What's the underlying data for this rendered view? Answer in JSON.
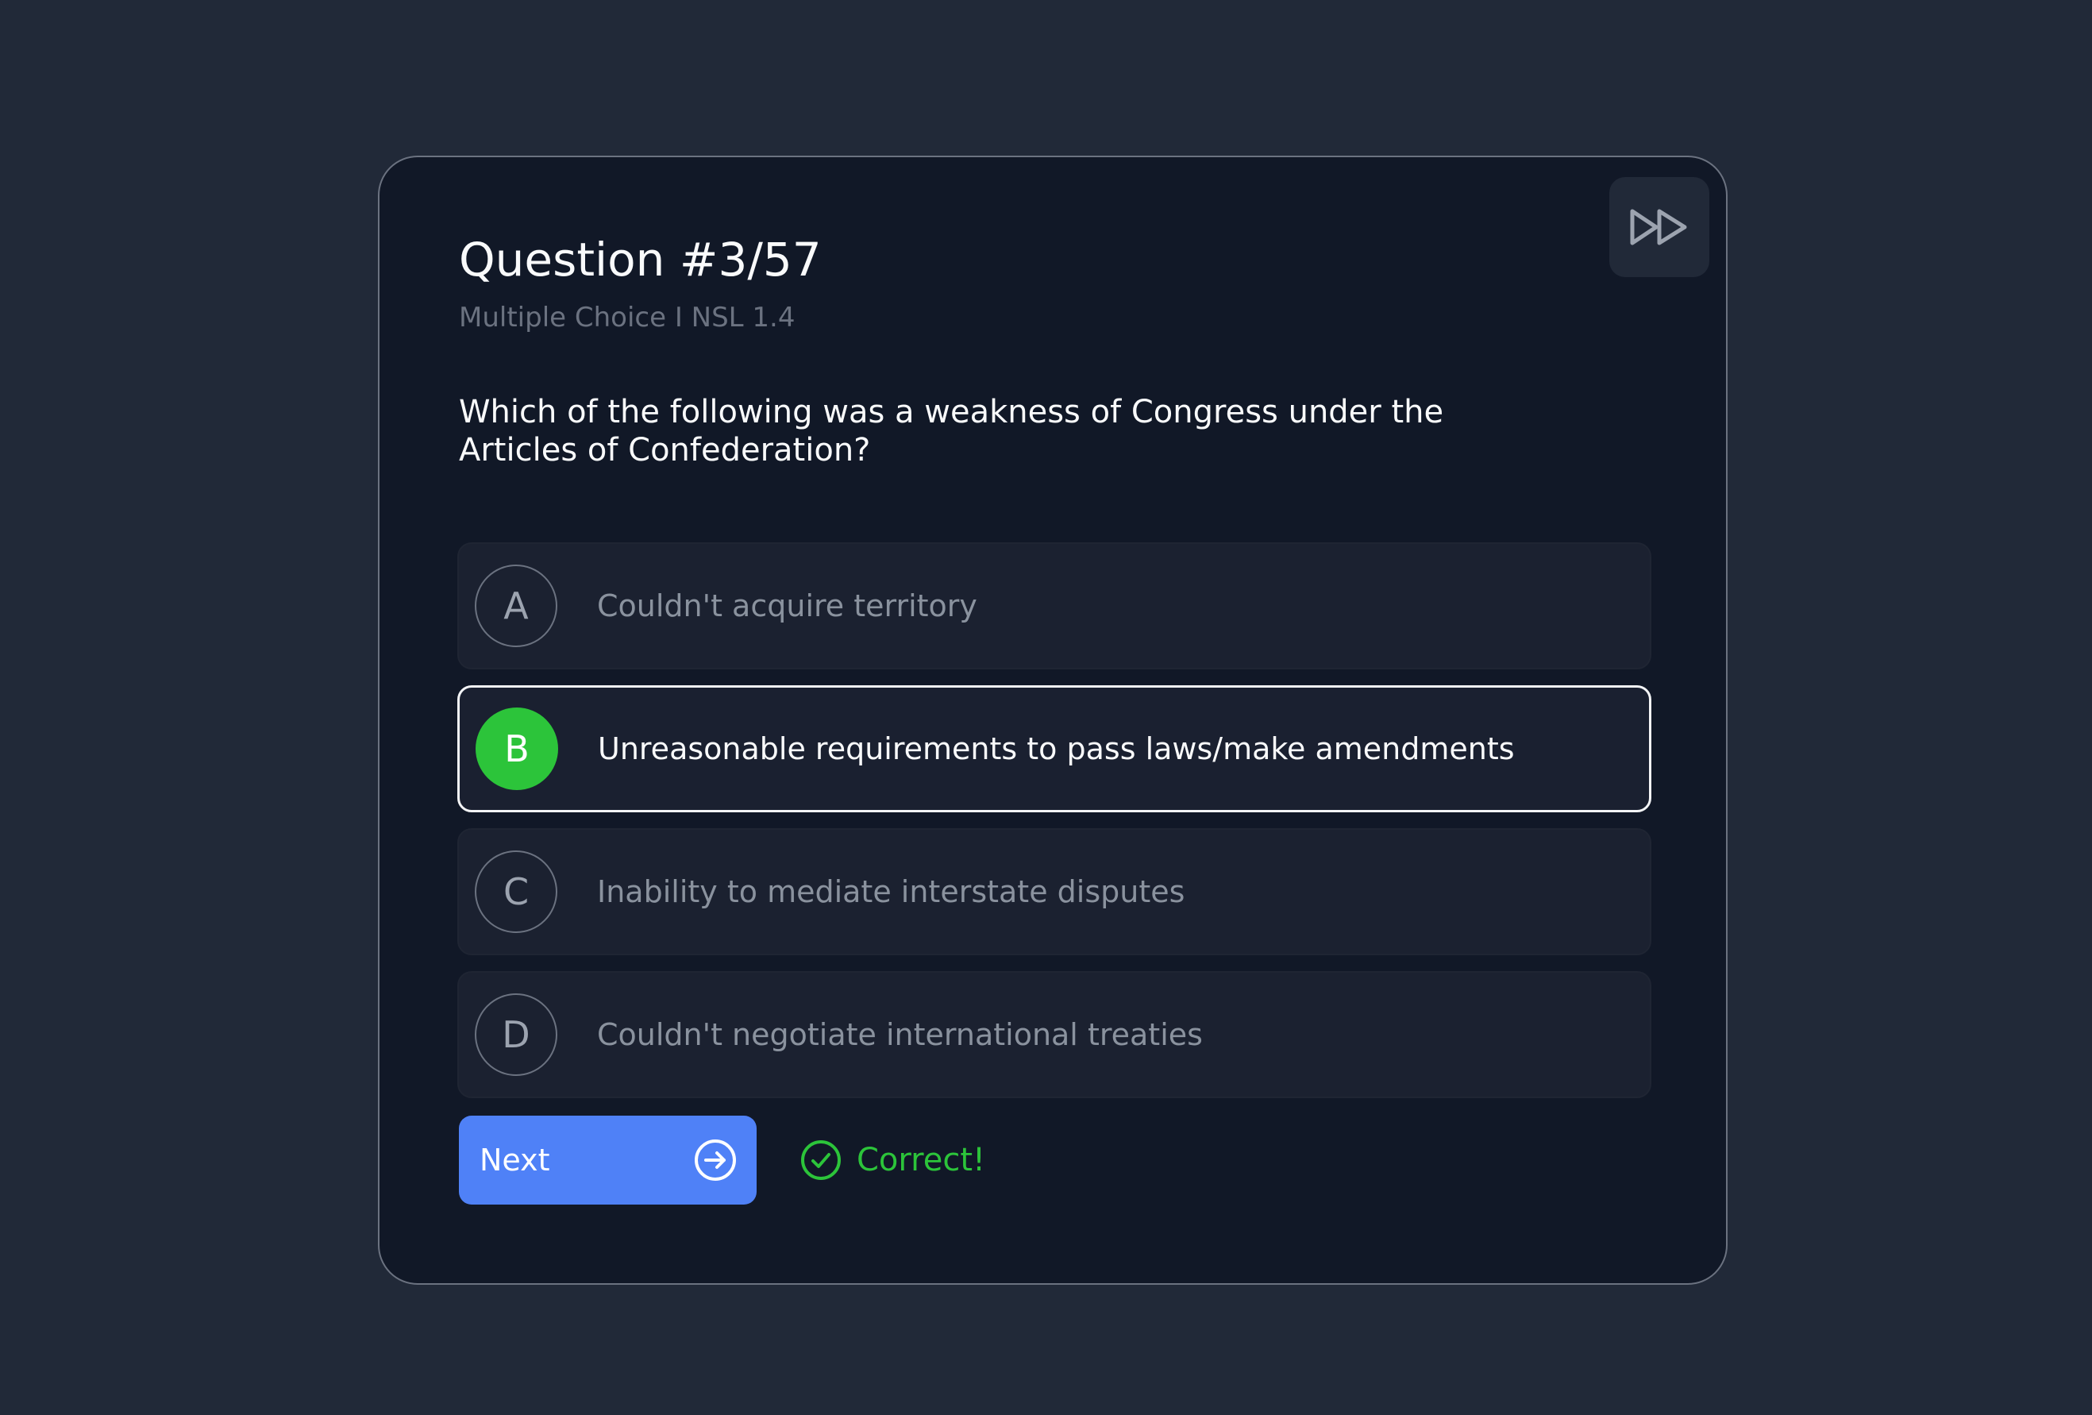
{
  "quiz": {
    "title": "Question #3/57",
    "subtitle": "Multiple Choice I NSL 1.4",
    "question": "Which of the following was a weakness of Congress under the Articles of Confederation?",
    "options": [
      {
        "letter": "A",
        "text": "Couldn't acquire territory",
        "selected": false
      },
      {
        "letter": "B",
        "text": "Unreasonable requirements to pass laws/make amendments",
        "selected": true
      },
      {
        "letter": "C",
        "text": "Inability to mediate interstate disputes",
        "selected": false
      },
      {
        "letter": "D",
        "text": "Couldn't negotiate international treaties",
        "selected": false
      }
    ]
  },
  "actions": {
    "next_label": "Next",
    "next_icon": "arrow-right-circle-icon",
    "skip_icon": "fast-forward-icon"
  },
  "feedback": {
    "text": "Correct!",
    "icon": "check-circle-icon",
    "color": "#2cc43a"
  },
  "colors": {
    "background": "#212938",
    "card": "#111827",
    "accent": "#4f81f7",
    "correct": "#2cc43a"
  }
}
